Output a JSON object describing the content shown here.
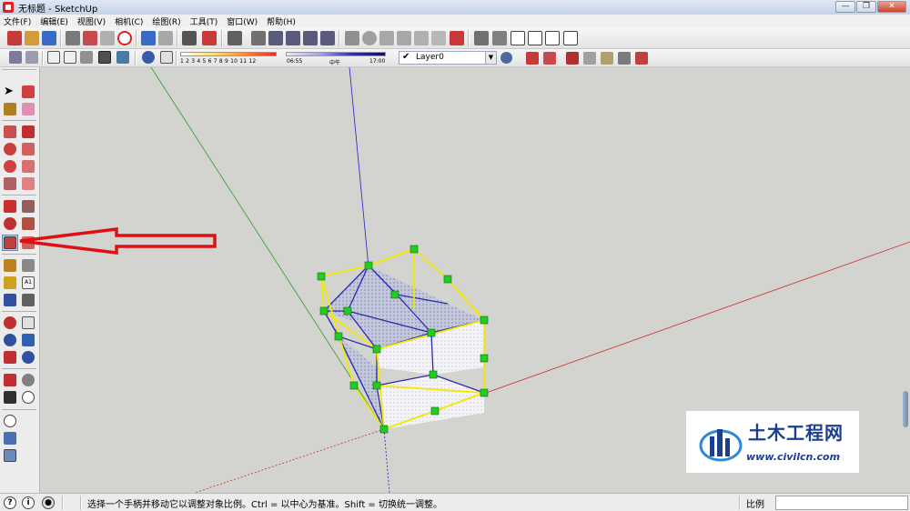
{
  "window": {
    "title": "无标题 - SketchUp",
    "minimize": "—",
    "maximize": "❐",
    "close": "✕"
  },
  "menu": [
    {
      "label": "文件(F)"
    },
    {
      "label": "编辑(E)"
    },
    {
      "label": "视图(V)"
    },
    {
      "label": "相机(C)"
    },
    {
      "label": "绘图(R)"
    },
    {
      "label": "工具(T)"
    },
    {
      "label": "窗口(W)"
    },
    {
      "label": "帮助(H)"
    }
  ],
  "shadow_month_slider": {
    "numbers": "1  2  3  4  5  6  7  8  9  10 11 12"
  },
  "shadow_time_slider": {
    "start": "06:55",
    "mid": "中午",
    "end": "17:00"
  },
  "layer": {
    "current": "Layer0",
    "checked": "✔"
  },
  "status": {
    "message": "选择一个手柄并移动它以调整对象比例。Ctrl = 以中心为基准。Shift = 切换统一调整。",
    "measure_label": "比例",
    "measure_value": ""
  },
  "watermark": {
    "title": "土木工程网",
    "url": "www.civilcn.com"
  },
  "colors": {
    "selection": "#f2e800",
    "grip": "#22cc22",
    "axis_red": "#cc2222",
    "axis_green": "#1f9b1f",
    "axis_blue": "#1a1acc",
    "arrow": "#dd1111"
  },
  "icons": {
    "app": "sketchup-logo-icon",
    "scale_tool": "scale-tool-icon"
  }
}
